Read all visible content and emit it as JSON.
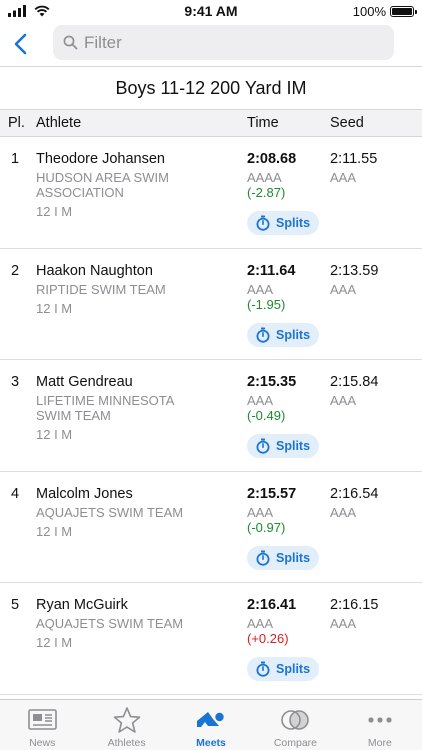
{
  "status": {
    "time": "9:41 AM",
    "battery": "100%"
  },
  "nav": {
    "filter_placeholder": "Filter"
  },
  "event": {
    "title": "Boys 11-12 200 Yard IM"
  },
  "columns": {
    "place": "Pl.",
    "athlete": "Athlete",
    "time": "Time",
    "seed": "Seed"
  },
  "results": [
    {
      "place": "1",
      "name": "Theodore Johansen",
      "team": "HUDSON AREA SWIM ASSOCIATION",
      "age_gender": "12 I M",
      "time": "2:08.68",
      "time_standard": "AAAA",
      "diff": "(-2.87)",
      "diff_sign": "neg",
      "seed": "2:11.55",
      "seed_standard": "AAA",
      "splits_label": "Splits"
    },
    {
      "place": "2",
      "name": "Haakon Naughton",
      "team": "RIPTIDE SWIM TEAM",
      "age_gender": "12 I M",
      "time": "2:11.64",
      "time_standard": "AAA",
      "diff": "(-1.95)",
      "diff_sign": "neg",
      "seed": "2:13.59",
      "seed_standard": "AAA",
      "splits_label": "Splits"
    },
    {
      "place": "3",
      "name": "Matt Gendreau",
      "team": "LIFETIME MINNESOTA SWIM TEAM",
      "age_gender": "12 I M",
      "time": "2:15.35",
      "time_standard": "AAA",
      "diff": "(-0.49)",
      "diff_sign": "neg",
      "seed": "2:15.84",
      "seed_standard": "AAA",
      "splits_label": "Splits"
    },
    {
      "place": "4",
      "name": "Malcolm Jones",
      "team": "AQUAJETS SWIM TEAM",
      "age_gender": "12 I M",
      "time": "2:15.57",
      "time_standard": "AAA",
      "diff": "(-0.97)",
      "diff_sign": "neg",
      "seed": "2:16.54",
      "seed_standard": "AAA",
      "splits_label": "Splits"
    },
    {
      "place": "5",
      "name": "Ryan McGuirk",
      "team": "AQUAJETS SWIM TEAM",
      "age_gender": "12 I M",
      "time": "2:16.41",
      "time_standard": "AAA",
      "diff": "(+0.26)",
      "diff_sign": "pos",
      "seed": "2:16.15",
      "seed_standard": "AAA",
      "splits_label": "Splits"
    }
  ],
  "tabbar": {
    "tabs": [
      {
        "label": "News",
        "icon": "newspaper-icon",
        "active": false
      },
      {
        "label": "Athletes",
        "icon": "star-icon",
        "active": false
      },
      {
        "label": "Meets",
        "icon": "swimmer-icon",
        "active": true
      },
      {
        "label": "Compare",
        "icon": "compare-icon",
        "active": false
      },
      {
        "label": "More",
        "icon": "more-dots-icon",
        "active": false
      }
    ]
  },
  "colors": {
    "accent": "#1a74d2",
    "negative_diff": "#1e8a2e",
    "positive_diff": "#d81e1e",
    "secondary_text": "#8e8e93"
  }
}
